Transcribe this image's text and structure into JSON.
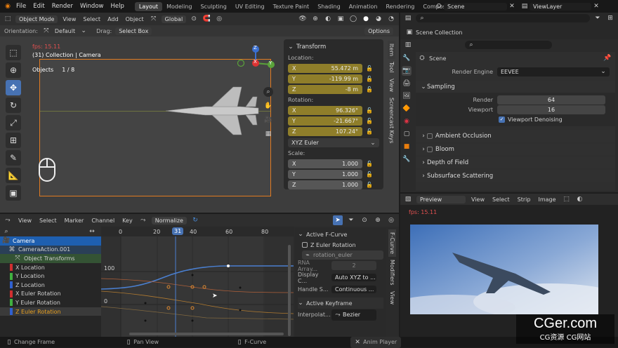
{
  "menu": [
    "File",
    "Edit",
    "Render",
    "Window",
    "Help"
  ],
  "workspaces": [
    "Layout",
    "Modeling",
    "Sculpting",
    "UV Editing",
    "Texture Paint",
    "Shading",
    "Animation",
    "Rendering",
    "Compositing"
  ],
  "top_right": {
    "scene": "Scene",
    "view_layer": "ViewLayer"
  },
  "viewport_header": {
    "mode": "Object Mode",
    "menus": [
      "View",
      "Select",
      "Add",
      "Object"
    ],
    "transform": "Global"
  },
  "viewport_sub": {
    "orientation_label": "Orientation:",
    "orientation": "Default",
    "drag_label": "Drag:",
    "drag": "Select Box",
    "options": "Options"
  },
  "viewport_overlay": {
    "fps": "fps: 15.11",
    "collection": "(31) Collection | Camera",
    "objects_label": "Objects",
    "objects_count": "1 / 8"
  },
  "gizmo": {
    "z": "Z",
    "y": "Y",
    "x": "X"
  },
  "n_panel": {
    "title": "Transform",
    "location_label": "Location:",
    "location": [
      {
        "axis": "X",
        "value": "55.472 m"
      },
      {
        "axis": "Y",
        "value": "-119.99 m"
      },
      {
        "axis": "Z",
        "value": "-8 m"
      }
    ],
    "rotation_label": "Rotation:",
    "rotation": [
      {
        "axis": "X",
        "value": "96.326°"
      },
      {
        "axis": "Y",
        "value": "-21.667°"
      },
      {
        "axis": "Z",
        "value": "107.24°"
      }
    ],
    "rotation_mode": "XYZ Euler",
    "scale_label": "Scale:",
    "scale": [
      {
        "axis": "X",
        "value": "1.000"
      },
      {
        "axis": "Y",
        "value": "1.000"
      },
      {
        "axis": "Z",
        "value": "1.000"
      }
    ],
    "tabs": [
      "Item",
      "Tool",
      "View",
      "Screencast Keys"
    ]
  },
  "outliner": {
    "title": "Scene Collection"
  },
  "properties": {
    "scene": "Scene",
    "render_engine_label": "Render Engine",
    "render_engine": "EEVEE",
    "sampling": "Sampling",
    "render_label": "Render",
    "render_value": "64",
    "viewport_label": "Viewport",
    "viewport_value": "16",
    "viewport_denoising": "Viewport Denoising",
    "sections": [
      "Ambient Occlusion",
      "Bloom",
      "Depth of Field",
      "Subsurface Scattering"
    ]
  },
  "preview": {
    "title": "Preview",
    "menus": [
      "View",
      "Select",
      "Strip",
      "Image"
    ],
    "fps": "fps: 15.11"
  },
  "graph_header": {
    "menus": [
      "View",
      "Select",
      "Marker",
      "Channel",
      "Key"
    ],
    "normalize": "Normalize"
  },
  "timeline": {
    "ticks": [
      "0",
      "20",
      "31",
      "40",
      "60",
      "80"
    ],
    "current": "31",
    "y_labels": [
      "100",
      "0"
    ]
  },
  "channels": [
    {
      "label": "Camera",
      "color": "#1e5fb0"
    },
    {
      "label": "CameraAction.001",
      "color": ""
    },
    {
      "label": "Object Transforms",
      "color": "#3a6b3a"
    },
    {
      "label": "X Location",
      "color": "#d03030"
    },
    {
      "label": "Y Location",
      "color": "#40b040"
    },
    {
      "label": "Z Location",
      "color": "#3060d0"
    },
    {
      "label": "X Euler Rotation",
      "color": "#d03030"
    },
    {
      "label": "Y Euler Rotation",
      "color": "#40b040"
    },
    {
      "label": "Z Euler Rotation",
      "color": "#3060d0"
    }
  ],
  "fcurve_panel": {
    "active_fcurve": "Active F-Curve",
    "name": "Z Euler Rotation",
    "path": "rotation_euler",
    "rna_label": "RNA Array...",
    "rna_value": "2",
    "display_label": "Display C...",
    "display_value": "Auto XYZ to ...",
    "handle_label": "Handle S...",
    "handle_value": "Continuous ...",
    "active_keyframe": "Active Keyframe",
    "interp_label": "Interpolat...",
    "interp_value": "Bezier",
    "tabs": [
      "F-Curve",
      "Modifiers",
      "View"
    ]
  },
  "status": {
    "left": "Change Frame",
    "mid": "Pan View",
    "right": "F-Curve",
    "anim": "Anim Player"
  },
  "watermark": {
    "main": "CGer.com",
    "sub": "CG资源 CG网站"
  }
}
